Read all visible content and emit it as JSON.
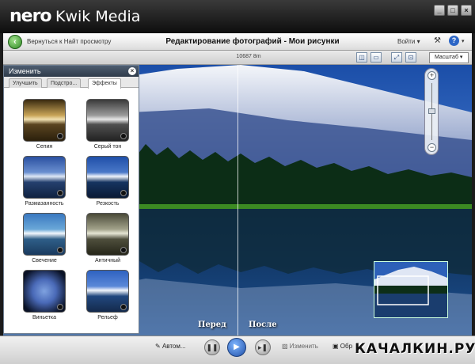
{
  "app": {
    "logo": "nero",
    "name": "Kwik Media"
  },
  "window_buttons": [
    "_",
    "□",
    "×"
  ],
  "nav": {
    "back_label": "Вернуться к Найт просмотру",
    "title": "Редактирование фотографий - Мои рисунки",
    "login": "Войти ▾",
    "tools_icon": "tools-icon",
    "help_icon": "?"
  },
  "toolbar": {
    "dimensions": "10687 8m",
    "zoom": "Масштаб ▾"
  },
  "panel": {
    "title": "Изменить",
    "close": "×",
    "tabs": [
      "Улучшить",
      "Подстро...",
      "Эффекты"
    ],
    "effects": [
      {
        "label": "Сепия",
        "tint": "#c8a457"
      },
      {
        "label": "Серый тон",
        "tint": "#9a9a9a"
      },
      {
        "label": "Размазанность",
        "tint": "#6a8fd0"
      },
      {
        "label": "Резкость",
        "tint": "#4a78c8"
      },
      {
        "label": "Свечение",
        "tint": "#6aa8d8"
      },
      {
        "label": "Античный",
        "tint": "#a2a28a"
      },
      {
        "label": "Виньетка",
        "tint": "#4a6ab8"
      },
      {
        "label": "Рельеф",
        "tint": "#5a88d8"
      }
    ]
  },
  "photo": {
    "label_before": "Перед",
    "label_after": "После"
  },
  "zoom": {
    "plus": "+",
    "minus": "−"
  },
  "bottom": {
    "auto": "Автом...",
    "edit": "Изменить",
    "share": "Обр",
    "watermark": "КАЧАЛКИН.РУ"
  }
}
